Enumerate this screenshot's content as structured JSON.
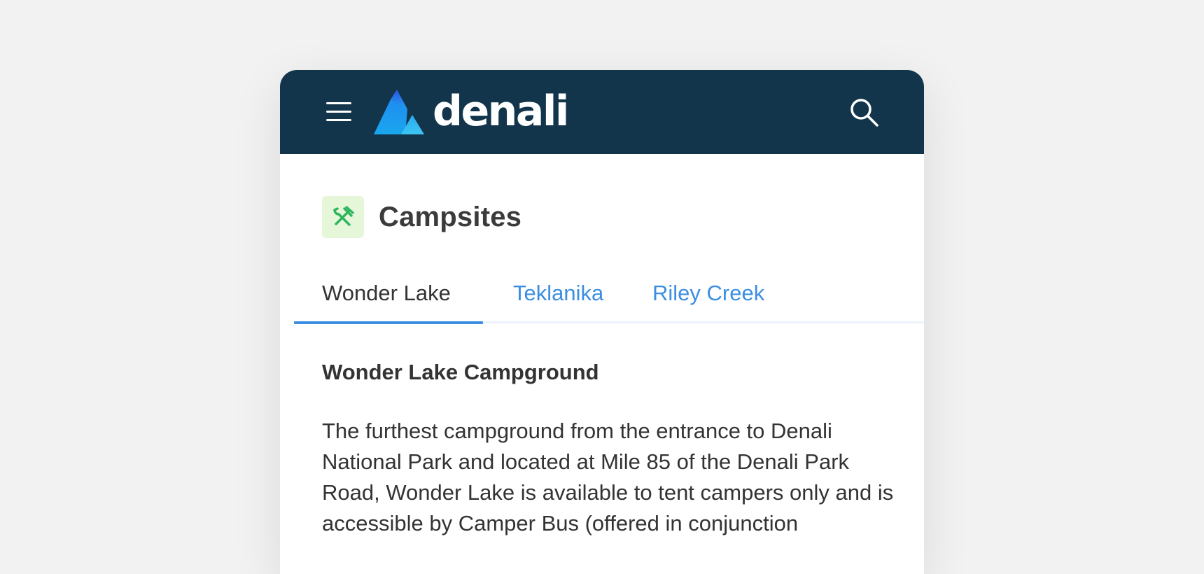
{
  "header": {
    "brand": "denali",
    "menu_icon": "hamburger-menu-icon",
    "search_icon": "search-icon",
    "background_color": "#12354c"
  },
  "section": {
    "title": "Campsites",
    "icon": "tools-icon",
    "icon_color": "#2db55d",
    "icon_background": "#e5f7d8"
  },
  "tabs": [
    {
      "label": "Wonder Lake",
      "active": true
    },
    {
      "label": "Teklanika",
      "active": false
    },
    {
      "label": "Riley Creek",
      "active": false
    }
  ],
  "content": {
    "title": "Wonder Lake Campground",
    "body": "The furthest campground from the entrance to Denali National Park and located at Mile 85 of the Denali Park Road, Wonder Lake is available to tent campers only and is accessible by Camper Bus (offered in conjunction"
  },
  "colors": {
    "accent": "#3b8ee0",
    "page_background": "#f2f2f3",
    "text": "#333333"
  }
}
